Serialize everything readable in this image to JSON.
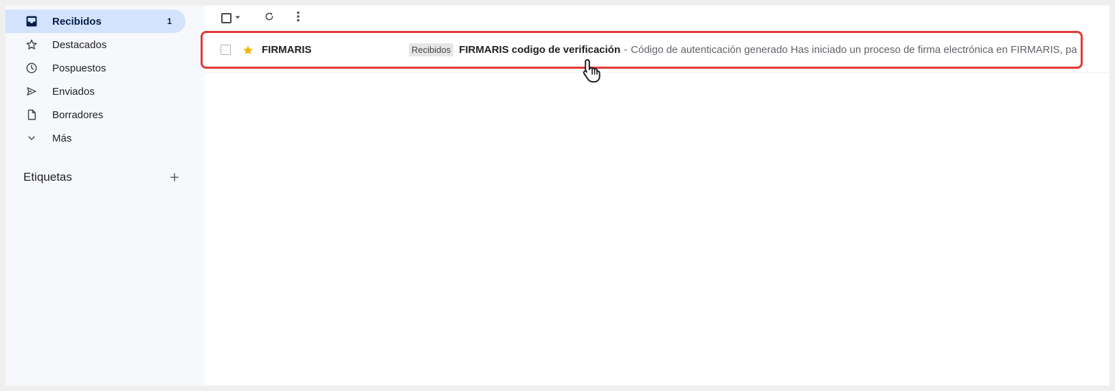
{
  "sidebar": {
    "items": [
      {
        "label": "Recibidos",
        "count": "1",
        "icon": "inbox-icon",
        "active": true
      },
      {
        "label": "Destacados",
        "icon": "star-outline-icon"
      },
      {
        "label": "Pospuestos",
        "icon": "clock-icon"
      },
      {
        "label": "Enviados",
        "icon": "send-icon"
      },
      {
        "label": "Borradores",
        "icon": "draft-icon"
      },
      {
        "label": "Más",
        "icon": "chevron-down-icon"
      }
    ],
    "labels_title": "Etiquetas"
  },
  "toolbar": {
    "icons": [
      "checkbox-icon",
      "caret-down-icon",
      "refresh-icon",
      "more-vert-icon"
    ]
  },
  "emails": [
    {
      "sender": "FIRMARIS",
      "tag": "Recibidos",
      "subject": "FIRMARIS codigo de verificación",
      "separator": "-",
      "snippet": "Código de autenticación generado Has iniciado un proceso de firma electrónica en FIRMARIS, pa",
      "starred": true
    }
  ],
  "colors": {
    "accent": "#d3e3fd",
    "highlight_border": "#e53935",
    "star": "#f4b400",
    "sidebar_bg": "#f6f8fc"
  }
}
